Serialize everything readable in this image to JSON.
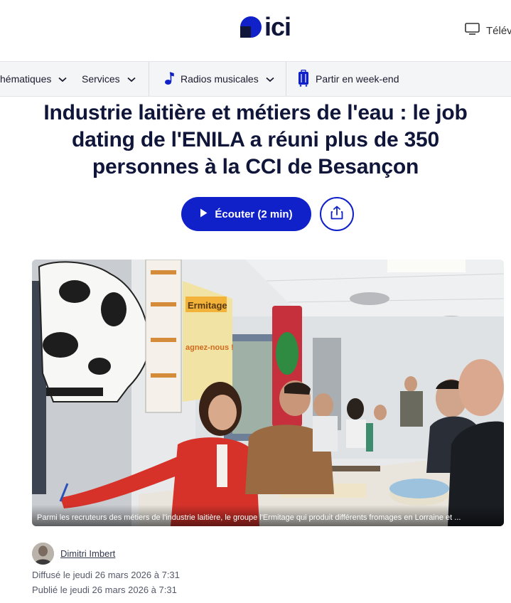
{
  "header": {
    "logo_text": "ici",
    "tv_label": "Télév"
  },
  "nav": {
    "items": [
      {
        "label": "hématiques",
        "icon": "chevron-down-icon"
      },
      {
        "label": "Services",
        "icon": "chevron-down-icon"
      },
      {
        "label": "Radios musicales",
        "icon": "music-note-icon"
      },
      {
        "label": "Partir en week-end",
        "icon": "luggage-icon"
      }
    ]
  },
  "article": {
    "title": "Industrie laitière et métiers de l'eau : le job dating de l'ENILA a réuni plus de 350 personnes à la CCI de Besançon",
    "listen_label": "Écouter (2 min)",
    "image_caption": "Parmi les recruteurs des métiers de l'industrie laitière, le groupe l'Ermitage qui produit différents fromages en Lorraine et ...",
    "image_signs": {
      "ermitage": "Ermitage",
      "gagnez": "agnez-nous !"
    },
    "author": "Dimitri Imbert",
    "broadcast": "Diffusé le jeudi 26 mars 2026 à 7:31",
    "published": "Publié le jeudi 26 mars 2026 à 7:31"
  },
  "colors": {
    "brand_blue": "#1021c9",
    "navy": "#10163a",
    "nav_bg": "#f4f5f7"
  }
}
